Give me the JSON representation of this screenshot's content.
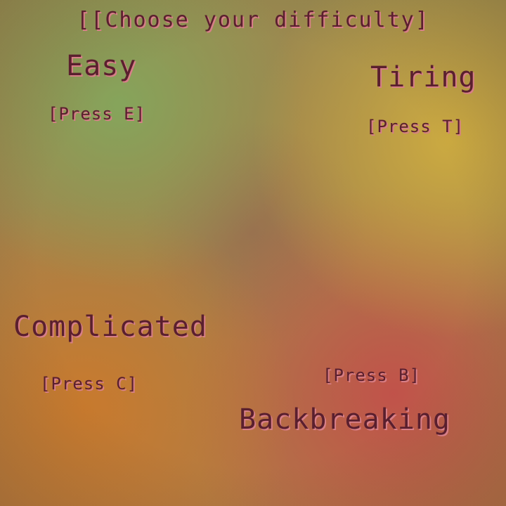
{
  "title": "[[Choose your difficulty]",
  "options": {
    "easy": {
      "label": "Easy",
      "key_hint": "[Press E]"
    },
    "tiring": {
      "label": "Tiring",
      "key_hint": "[Press T]"
    },
    "complicated": {
      "label": "Complicated",
      "key_hint": "[Press C]"
    },
    "backbreaking": {
      "label": "Backbreaking",
      "key_hint": "[Press B]"
    }
  },
  "colors": {
    "text": "#5a1f2e",
    "text_shadow": "#d77f88",
    "bg_green": "#84a65c",
    "bg_yellow": "#ceac40",
    "bg_orange": "#ca7a2c",
    "bg_red": "#c2504a"
  }
}
